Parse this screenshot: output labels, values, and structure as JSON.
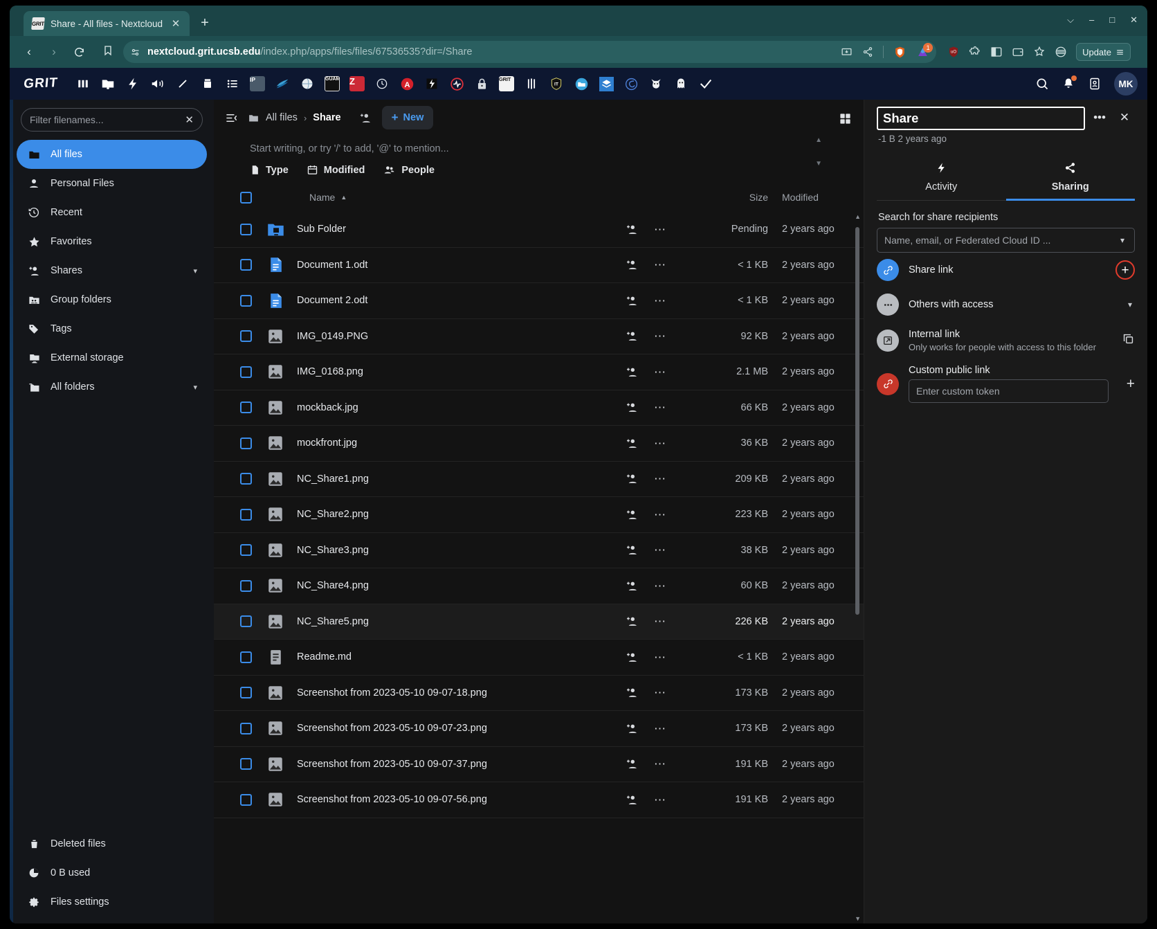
{
  "browser": {
    "tab": {
      "title": "Share - All files - Nextcloud",
      "favicon_label": "GRIT",
      "close": "✕"
    },
    "new_tab": "+",
    "window_controls": {
      "minimize": "–",
      "maximize": "□",
      "close": "✕",
      "list_tabs": "⌵"
    },
    "nav": {
      "back": "‹",
      "forward": "›",
      "reload": "↻"
    },
    "url": {
      "host": "nextcloud.grit.ucsb.edu",
      "path": "/index.php/apps/files/files/67536535?dir=/Share"
    },
    "update_button": "Update",
    "extension_badge": "1",
    "brave_badge": "1"
  },
  "nc_header": {
    "logo": "GRIT",
    "apps": [
      {
        "name": "dashboard-icon",
        "label": "|||"
      },
      {
        "name": "files-icon",
        "label": ""
      },
      {
        "name": "activity-icon",
        "label": ""
      },
      {
        "name": "announcements-icon",
        "label": ""
      },
      {
        "name": "notes-icon",
        "label": ""
      },
      {
        "name": "bookstack-icon",
        "label": ""
      },
      {
        "name": "tasks-icon",
        "label": ""
      },
      {
        "name": "ip-tool-icon",
        "label": "IP"
      },
      {
        "name": "elsevier-icon",
        "label": ""
      },
      {
        "name": "globe-icon",
        "label": ""
      },
      {
        "name": "guam-icon",
        "label": "GUAM"
      },
      {
        "name": "zotero-icon",
        "label": "Z"
      },
      {
        "name": "clock-icon",
        "label": ""
      },
      {
        "name": "analytics-icon",
        "label": "A"
      },
      {
        "name": "lightning-dark-icon",
        "label": ""
      },
      {
        "name": "heartbeat-icon",
        "label": ""
      },
      {
        "name": "password-icon",
        "label": ""
      },
      {
        "name": "grit-app-icon",
        "label": "GRIT"
      },
      {
        "name": "columns-icon",
        "label": ""
      },
      {
        "name": "shield-it-icon",
        "label": "IT"
      },
      {
        "name": "folder-blue-icon",
        "label": ""
      },
      {
        "name": "layers-icon",
        "label": ""
      },
      {
        "name": "swirl-icon",
        "label": ""
      },
      {
        "name": "fox-icon",
        "label": ""
      },
      {
        "name": "ghost-icon",
        "label": ""
      },
      {
        "name": "check-icon",
        "label": "✓"
      }
    ],
    "right": {
      "search": "search-icon",
      "notifications": "bell-icon",
      "contacts": "contacts-icon",
      "avatar_initials": "MK"
    }
  },
  "sidebar": {
    "filter_placeholder": "Filter filenames...",
    "filter_value": "",
    "clear_label": "✕",
    "items": [
      {
        "label": "All files",
        "icon": "folder-icon",
        "active": true,
        "chevron": false
      },
      {
        "label": "Personal Files",
        "icon": "person-icon",
        "active": false,
        "chevron": false
      },
      {
        "label": "Recent",
        "icon": "clock-rewind-icon",
        "active": false,
        "chevron": false
      },
      {
        "label": "Favorites",
        "icon": "star-icon",
        "active": false,
        "chevron": false
      },
      {
        "label": "Shares",
        "icon": "account-plus-icon",
        "active": false,
        "chevron": true
      },
      {
        "label": "Group folders",
        "icon": "group-folder-icon",
        "active": false,
        "chevron": false
      },
      {
        "label": "Tags",
        "icon": "tag-icon",
        "active": false,
        "chevron": false
      },
      {
        "label": "External storage",
        "icon": "external-storage-icon",
        "active": false,
        "chevron": false
      },
      {
        "label": "All folders",
        "icon": "folder-multiple-icon",
        "active": false,
        "chevron": true
      }
    ],
    "bottom": [
      {
        "label": "Deleted files",
        "icon": "trash-icon"
      },
      {
        "label": "0 B used",
        "icon": "pie-chart-icon"
      },
      {
        "label": "Files settings",
        "icon": "gear-icon"
      }
    ]
  },
  "files": {
    "breadcrumb": [
      {
        "label": "All files",
        "icon": "folder-icon"
      },
      {
        "label": "Share",
        "icon": ""
      }
    ],
    "breadcrumb_separator": "›",
    "new_button": "New",
    "new_plus": "+",
    "rich_workspace_placeholder": "Start writing, or try '/' to add, '@' to mention...",
    "quick_filters": [
      {
        "label": "Type",
        "icon": "file-icon"
      },
      {
        "label": "Modified",
        "icon": "calendar-icon"
      },
      {
        "label": "People",
        "icon": "people-icon"
      }
    ],
    "columns": {
      "name": "Name",
      "size": "Size",
      "modified": "Modified"
    },
    "sort_indicator": "▲",
    "rows": [
      {
        "name": "Sub Folder",
        "ext": "",
        "icon": "folder-shared-icon",
        "size": "Pending",
        "modified": "2 years ago",
        "highlight": false
      },
      {
        "name": "Document 1",
        "ext": ".odt",
        "icon": "document-icon",
        "size": "< 1 KB",
        "modified": "2 years ago",
        "highlight": false
      },
      {
        "name": "Document 2",
        "ext": ".odt",
        "icon": "document-icon",
        "size": "< 1 KB",
        "modified": "2 years ago",
        "highlight": false
      },
      {
        "name": "IMG_0149",
        "ext": ".PNG",
        "icon": "image-icon",
        "size": "92 KB",
        "modified": "2 years ago",
        "highlight": false
      },
      {
        "name": "IMG_0168",
        "ext": ".png",
        "icon": "image-icon",
        "size": "2.1 MB",
        "modified": "2 years ago",
        "highlight": false
      },
      {
        "name": "mockback",
        "ext": ".jpg",
        "icon": "image-icon",
        "size": "66 KB",
        "modified": "2 years ago",
        "highlight": false
      },
      {
        "name": "mockfront",
        "ext": ".jpg",
        "icon": "image-icon",
        "size": "36 KB",
        "modified": "2 years ago",
        "highlight": false
      },
      {
        "name": "NC_Share1",
        "ext": ".png",
        "icon": "image-icon",
        "size": "209 KB",
        "modified": "2 years ago",
        "highlight": false
      },
      {
        "name": "NC_Share2",
        "ext": ".png",
        "icon": "image-icon",
        "size": "223 KB",
        "modified": "2 years ago",
        "highlight": false
      },
      {
        "name": "NC_Share3",
        "ext": ".png",
        "icon": "image-icon",
        "size": "38 KB",
        "modified": "2 years ago",
        "highlight": false
      },
      {
        "name": "NC_Share4",
        "ext": ".png",
        "icon": "image-icon",
        "size": "60 KB",
        "modified": "2 years ago",
        "highlight": false
      },
      {
        "name": "NC_Share5",
        "ext": ".png",
        "icon": "image-icon",
        "size": "226 KB",
        "modified": "2 years ago",
        "highlight": true
      },
      {
        "name": "Readme",
        "ext": ".md",
        "icon": "markdown-icon",
        "size": "< 1 KB",
        "modified": "2 years ago",
        "highlight": false
      },
      {
        "name": "Screenshot from 2023-05-10 09-07-18",
        "ext": ".png",
        "icon": "image-icon",
        "size": "173 KB",
        "modified": "2 years ago",
        "highlight": false
      },
      {
        "name": "Screenshot from 2023-05-10 09-07-23",
        "ext": ".png",
        "icon": "image-icon",
        "size": "173 KB",
        "modified": "2 years ago",
        "highlight": false
      },
      {
        "name": "Screenshot from 2023-05-10 09-07-37",
        "ext": ".png",
        "icon": "image-icon",
        "size": "191 KB",
        "modified": "2 years ago",
        "highlight": false
      },
      {
        "name": "Screenshot from 2023-05-10 09-07-56",
        "ext": ".png",
        "icon": "image-icon",
        "size": "191 KB",
        "modified": "2 years ago",
        "highlight": false
      }
    ]
  },
  "details": {
    "title_value": "Share",
    "subtitle": "-1 B 2 years ago",
    "menu_dots": "•••",
    "close": "✕",
    "tabs": [
      {
        "label": "Activity",
        "icon": "lightning-icon",
        "active": false
      },
      {
        "label": "Sharing",
        "icon": "share-icon",
        "active": true
      }
    ],
    "recipients_label": "Search for share recipients",
    "recipients_placeholder": "Name, email, or Federated Cloud ID ...",
    "recipients_value": "",
    "share_link": {
      "label": "Share link",
      "icon": "link-icon",
      "add": "+",
      "accent": "#3b8ce8"
    },
    "others_access": {
      "label": "Others with access",
      "icon": "dots-icon",
      "chevron": "▾"
    },
    "internal_link": {
      "label": "Internal link",
      "description": "Only works for people with access to this folder",
      "icon": "open-in-new-icon",
      "copy": "copy-icon"
    },
    "custom_link": {
      "label": "Custom public link",
      "icon": "link-red-icon",
      "placeholder": "Enter custom token",
      "value": "",
      "add": "+",
      "accent": "#c8372a"
    }
  }
}
